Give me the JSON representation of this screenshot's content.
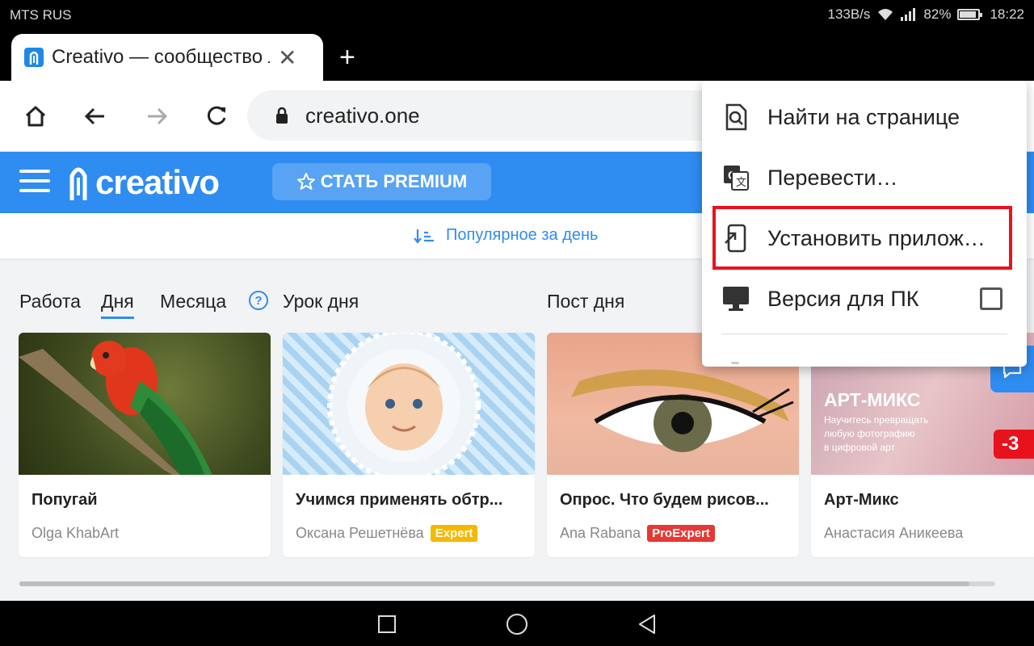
{
  "status_bar": {
    "carrier": "MTS RUS",
    "net_speed": "133B/s",
    "battery": "82%",
    "battery_level": 0.82,
    "time": "18:22"
  },
  "browser": {
    "tab_title": "Creativo — сообщество л",
    "url": "creativo.one",
    "new_tab_icon": "plus-icon"
  },
  "site": {
    "logo_text": "creativo",
    "premium_label": "СТАТЬ PREMIUM",
    "sort_label": "Популярное за день",
    "brand_color": "#2f8cf0"
  },
  "sections": {
    "work": "Работа",
    "day": "Дня",
    "month": "Месяца",
    "help": "?",
    "lesson_of_day": "Урок дня",
    "post_of_day": "Пост дня"
  },
  "cards": [
    {
      "title": "Попугай",
      "author": "Olga KhabArt",
      "badge": ""
    },
    {
      "title": "Учимся применять обтр...",
      "author": "Оксана Решетнёва",
      "badge": "Expert"
    },
    {
      "title": "Опрос. Что будем рисов...",
      "author": "Ana Rabana",
      "badge": "ProExpert"
    },
    {
      "title": "Арт-Микс",
      "author": "Анастасия Аникеева",
      "badge": ""
    }
  ],
  "promo": {
    "heading": "АРТ-МИКС",
    "text_line1": "Научитесь превращать",
    "text_line2": "любую фотографию",
    "text_line3": "в цифровой арт",
    "discount": "-3"
  },
  "menu": {
    "find": "Найти на странице",
    "translate": "Перевести…",
    "install": "Установить прилож…",
    "desktop": "Версия для ПК",
    "highlight_color": "#e8121c"
  }
}
